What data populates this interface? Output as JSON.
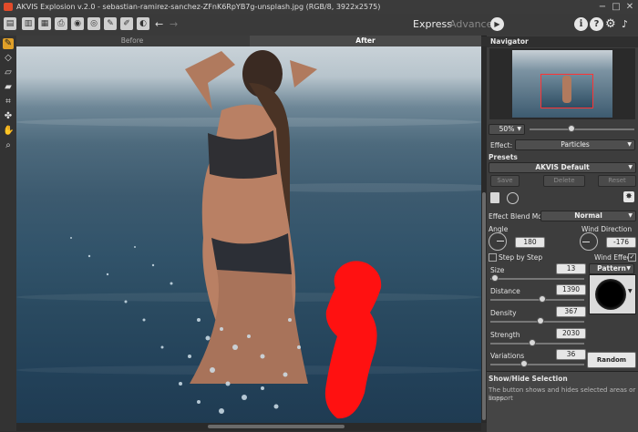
{
  "window": {
    "title": "AKVIS Explosion v.2.0 - sebastian-ramirez-sanchez-ZFnK6RpYB7g-unsplash.jpg (RGB/8, 3922x2575)",
    "minimize": "−",
    "maximize": "□",
    "close": "✕"
  },
  "toolbar": {
    "mode_express": "Express",
    "mode_advanced": "Advanced",
    "run_icon": "play-icon",
    "info": "i",
    "help": "?",
    "settings": "⚙",
    "bell": "🔔"
  },
  "tabs": {
    "before": "Before",
    "after": "After"
  },
  "navigator": {
    "title": "Navigator",
    "zoom": "50%"
  },
  "effect": {
    "label": "Effect:",
    "value": "Particles"
  },
  "presets": {
    "title": "Presets",
    "value": "AKVIS Default",
    "save": "Save",
    "delete": "Delete",
    "reset": "Reset"
  },
  "settings": {
    "blend_label": "Effect Blend Mode",
    "blend_value": "Normal",
    "angle_label": "Angle",
    "angle_value": "180",
    "wind_dir_label": "Wind Direction",
    "wind_dir_value": "-176",
    "step_label": "Step by Step",
    "step_checked": false,
    "wind_effect_label": "Wind Effect",
    "wind_effect_checked": true,
    "size_label": "Size",
    "size_value": "13",
    "size_level": 0.05,
    "pattern_label": "Pattern",
    "distance_label": "Distance",
    "distance_value": "1390",
    "distance_level": 0.55,
    "density_label": "Density",
    "density_value": "367",
    "density_level": 0.53,
    "strength_label": "Strength",
    "strength_value": "2030",
    "strength_level": 0.45,
    "variations_label": "Variations",
    "variations_value": "36",
    "variations_level": 0.36,
    "random_seed": "Random Seed"
  },
  "help_panel": {
    "title": "Show/Hide Selection",
    "text_line1": "The button shows and hides selected areas or support",
    "text_line2": "lines."
  },
  "colors": {
    "selection": "#ff1111",
    "canvas_water": "#2f5168"
  }
}
